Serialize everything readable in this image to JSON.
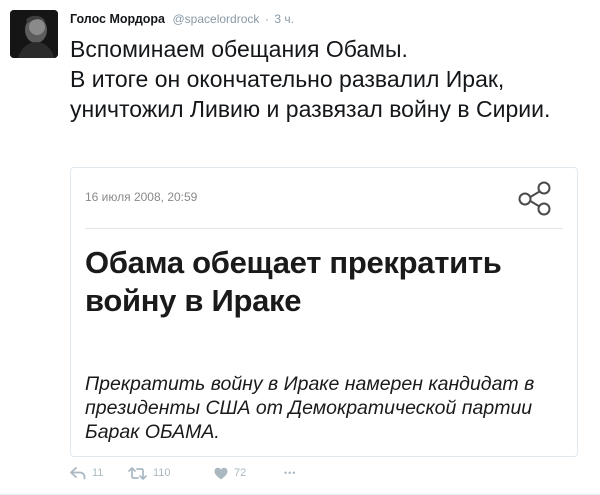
{
  "tweet": {
    "author_name": "Голос Мордора",
    "handle": "@spacelordrock",
    "separator": "·",
    "time": "3 ч.",
    "text_line1": "Вспоминаем обещания Обамы.",
    "text_line2": "В итоге он окончательно развалил Ирак, уничтожил Ливию и развязал войну в Сирии."
  },
  "card": {
    "date": "16 июля 2008, 20:59",
    "headline": "Обама обещает прекратить войну в Ираке",
    "body": "Прекратить войну в Ираке намерен кандидат в президенты США от Демократической партии Барак ОБАМА."
  },
  "actions": {
    "reply_count": "11",
    "retweet_count": "110",
    "like_count": "72",
    "more_label": "•••"
  },
  "colors": {
    "muted": "#8899a6",
    "action_icon": "#aab8c2",
    "border": "#e1e8ed"
  },
  "icons": {
    "reply": "reply-icon",
    "retweet": "retweet-icon",
    "like": "heart-icon",
    "more": "more-icon",
    "share": "share-icon"
  }
}
